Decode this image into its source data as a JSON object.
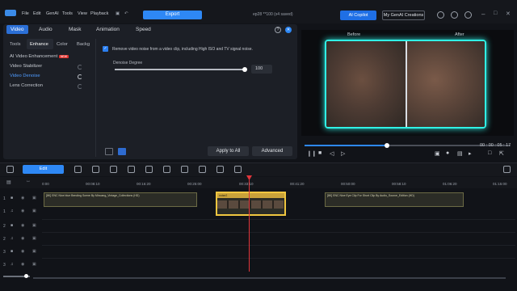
{
  "menu": {
    "items": [
      "File",
      "Edit",
      "GenAI",
      "Tools",
      "View",
      "Playback"
    ],
    "export_label": "Export",
    "project_title": "ep28 **100 (x4 saved)",
    "ai_copilot_label": "AI Copilot",
    "genai_label": "My GenAI Creations"
  },
  "panel": {
    "main_tabs": [
      "Video",
      "Audio",
      "Mask",
      "Animation",
      "Speed"
    ],
    "sub_tabs": [
      "Tools",
      "Enhance",
      "Color",
      "Backg"
    ],
    "side_items": [
      {
        "label": "AI Video Enhancement",
        "badge": "NEW"
      },
      {
        "label": "Video Stabilizer"
      },
      {
        "label": "Video Denoise"
      },
      {
        "label": "Lens Correction"
      }
    ],
    "checkbox_text": "Remove video noise from a video clip, including High ISO and TV signal noise.",
    "slider_label": "Denoise Degree",
    "slider_value": "100",
    "slider_fraction": 0.99,
    "apply_all_label": "Apply to All",
    "advanced_label": "Advanced"
  },
  "preview": {
    "before_label": "Before",
    "after_label": "After",
    "timecode": "00 : 00 : 05 : 17",
    "progress_fraction": 0.4
  },
  "toolbar": {
    "edit_label": "Edit"
  },
  "timeline": {
    "ticks": [
      "0:00",
      "00:08:10",
      "00:16:20",
      "00:25:00",
      "00:33:10",
      "00:41:20",
      "00:50:00",
      "00:58:10",
      "01:06:20",
      "01:15:00"
    ],
    "clips": [
      {
        "name": "[8K] ENC Nice blue Bending Scene By Minoang_Vintage_Collections (HD)"
      },
      {
        "name": "noise2"
      },
      {
        "name": "[8K] ENC Nice Eye Clip For Short Clip By Audio_Source_Edition (HD)"
      }
    ],
    "track_numbers": [
      "1",
      "1",
      "2",
      "2",
      "3",
      "3"
    ]
  }
}
